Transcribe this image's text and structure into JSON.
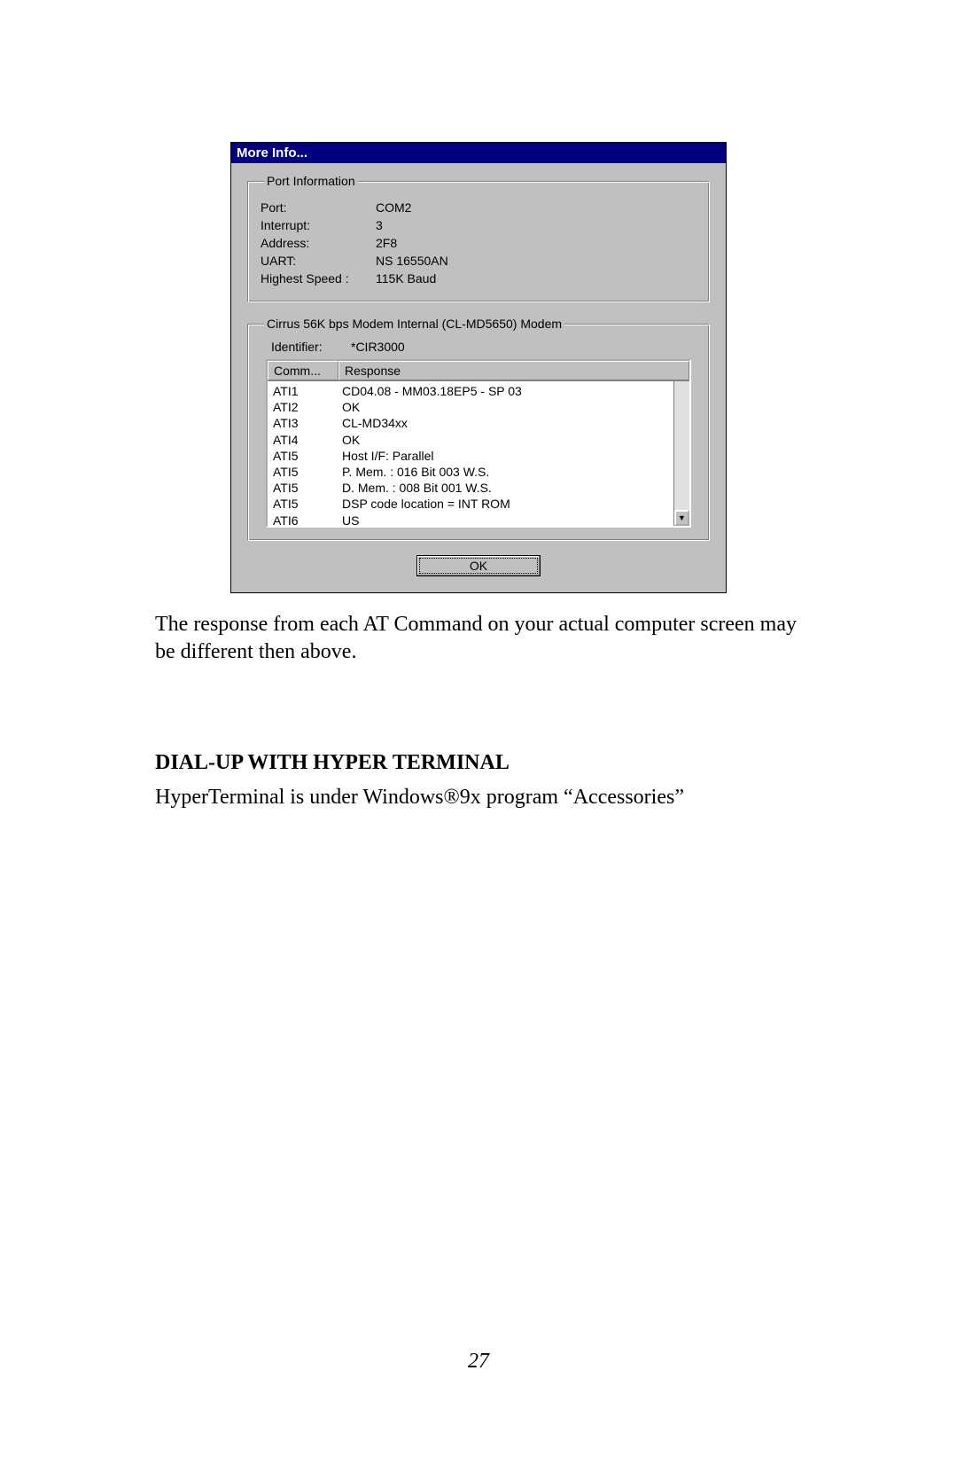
{
  "dialog": {
    "title": "More Info...",
    "port_info": {
      "legend": "Port Information",
      "rows": [
        {
          "label": "Port:",
          "value": "COM2"
        },
        {
          "label": "Interrupt:",
          "value": "3"
        },
        {
          "label": "Address:",
          "value": "2F8"
        },
        {
          "label": "UART:",
          "value": "NS 16550AN"
        },
        {
          "label": "Highest Speed :",
          "value": "115K Baud"
        }
      ]
    },
    "modem_info": {
      "legend": "Cirrus 56K bps Modem Internal (CL-MD5650) Modem",
      "identifier_label": "Identifier:",
      "identifier_value": "*CIR3000",
      "columns": {
        "comm": "Comm...",
        "response": "Response"
      },
      "rows": [
        {
          "comm": "ATI1",
          "response": "CD04.08 - MM03.18EP5 - SP 03"
        },
        {
          "comm": "ATI2",
          "response": "OK"
        },
        {
          "comm": "ATI3",
          "response": "CL-MD34xx"
        },
        {
          "comm": "ATI4",
          "response": "OK"
        },
        {
          "comm": "ATI5",
          "response": "Host I/F: Parallel"
        },
        {
          "comm": "ATI5",
          "response": "P. Mem. : 016 Bit 003 W.S."
        },
        {
          "comm": "ATI5",
          "response": "D. Mem. : 008 Bit 001 W.S."
        },
        {
          "comm": "ATI5",
          "response": "DSP code location = INT ROM"
        },
        {
          "comm": "ATI6",
          "response": "US"
        }
      ]
    },
    "ok_label": "OK"
  },
  "body": {
    "paragraph1": "The response from each AT Command on your actual computer screen may be different then above.",
    "heading": "DIAL-UP WITH HYPER TERMINAL",
    "paragraph2": "HyperTerminal is  under Windows®9x program “Accessories”"
  },
  "page_number": "27"
}
